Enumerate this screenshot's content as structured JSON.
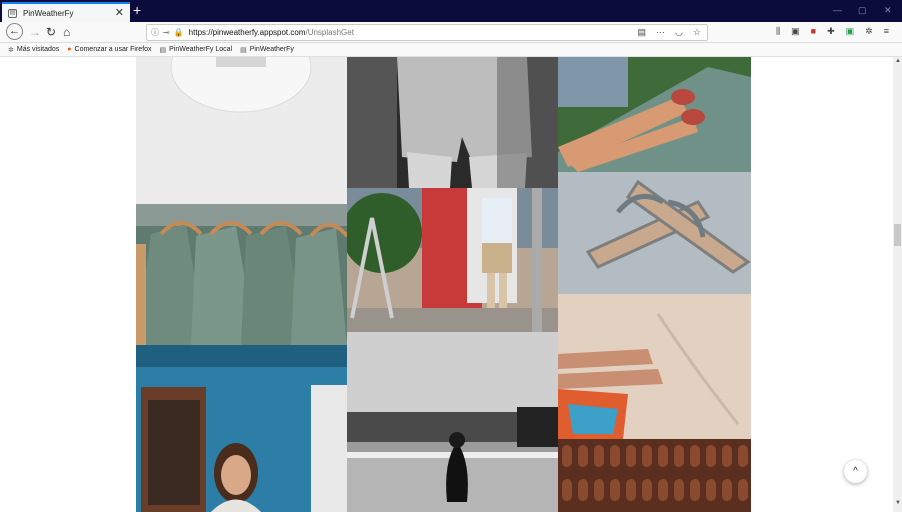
{
  "browser": {
    "tab_title": "PinWeatherFy",
    "tab_close": "✕",
    "new_tab": "+",
    "url_host": "https://pinweatherfy.appspot.com",
    "url_path": "/UnsplashGet",
    "window_controls": [
      "—",
      "▢",
      "✕"
    ]
  },
  "bookmarks": [
    {
      "label": "Más visitados",
      "icon": "gear-icon"
    },
    {
      "label": "Comenzar a usar Firefox",
      "icon": "firefox-icon"
    },
    {
      "label": "PinWeatherFy Local",
      "icon": "page-icon"
    },
    {
      "label": "PinWeatherFy",
      "icon": "page-icon"
    }
  ],
  "gallery": {
    "columns": 3,
    "photos": [
      {
        "subject": "white t-shirt",
        "color": "#e9ecef"
      },
      {
        "subject": "denim shorts bw",
        "color": "#6b6b6b"
      },
      {
        "subject": "legs and sandals on bench",
        "color": "#b88266"
      },
      {
        "subject": "green shirts on hangers",
        "color": "#6f8c7e"
      },
      {
        "subject": "street shopping scene",
        "color": "#8a6d56"
      },
      {
        "subject": "sandals on sand",
        "color": "#b9c1c8"
      },
      {
        "subject": "woman by blue door",
        "color": "#2f6d8f"
      },
      {
        "subject": "bw seaside scene",
        "color": "#8b8b8b"
      },
      {
        "subject": "feet on beach sand",
        "color": "#d7c4b4"
      },
      {
        "subject": "rows of sandals",
        "color": "#6b3d2a"
      }
    ]
  },
  "back_to_top": "^"
}
